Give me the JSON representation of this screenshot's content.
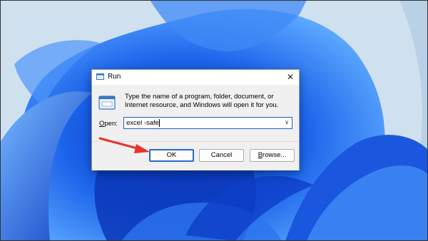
{
  "dialog": {
    "title": "Run",
    "close_glyph": "✕",
    "description": "Type the name of a program, folder, document, or Internet resource, and Windows will open it for you.",
    "open_label": "Open:",
    "open_value": "excel -safe",
    "buttons": {
      "ok": "OK",
      "cancel": "Cancel",
      "browse": "Browse..."
    }
  },
  "colors": {
    "accent": "#2a6ac6",
    "annotation_arrow": "#e8332a",
    "wallpaper_blue": "#1f5fe0"
  },
  "icons": [
    "run-app-icon",
    "close-icon",
    "dropdown-arrow-icon"
  ]
}
